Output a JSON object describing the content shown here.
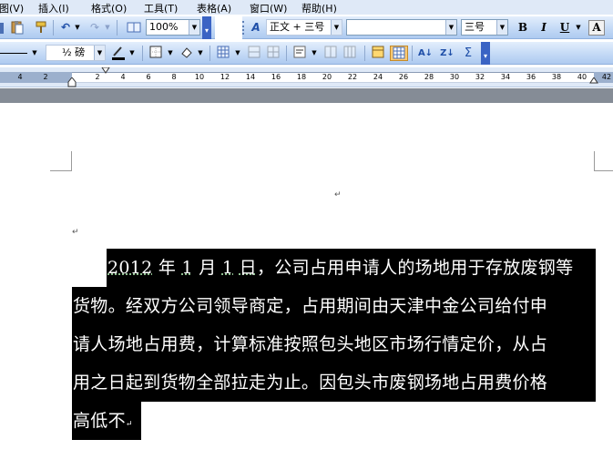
{
  "menubar": {
    "items": [
      "图(V)",
      "插入(I)",
      "格式(O)",
      "工具(T)",
      "表格(A)",
      "窗口(W)",
      "帮助(H)"
    ]
  },
  "toolbar1": {
    "zoom": "100%",
    "style": "正文 + 三号",
    "font": "",
    "font_size": "三号",
    "bold": "B",
    "italic": "I",
    "underline": "U",
    "char_border": "A"
  },
  "toolbar2": {
    "border_combo": "½ 磅",
    "sigma": "Σ"
  },
  "ruler": {
    "labels": [
      "4",
      "2",
      "2",
      "4",
      "6",
      "8",
      "10",
      "12",
      "14",
      "16",
      "18",
      "20",
      "22",
      "24",
      "26",
      "28",
      "30",
      "32",
      "34",
      "36",
      "38",
      "40",
      "42"
    ]
  },
  "document": {
    "lines": [
      {
        "prefix": "",
        "u1": "2012",
        "m1": " 年 ",
        "u2": "1",
        "m2": " 月 ",
        "u3": "1",
        "m3": " ",
        "u4": "日",
        "rest": "，公司占用申请人的场地用于存放废钢等"
      },
      {
        "text": "货物。经双方公司领导商定，占用期间由天津中金公司给付申"
      },
      {
        "text": "请人场地占用费，计算标准按照包头地区市场行情定价，从占"
      },
      {
        "text": "用之日起到货物全部拉走为止。因包头市废钢场地占用费价格"
      },
      {
        "text": "高低不"
      }
    ],
    "paragraph_mark": "↵"
  }
}
